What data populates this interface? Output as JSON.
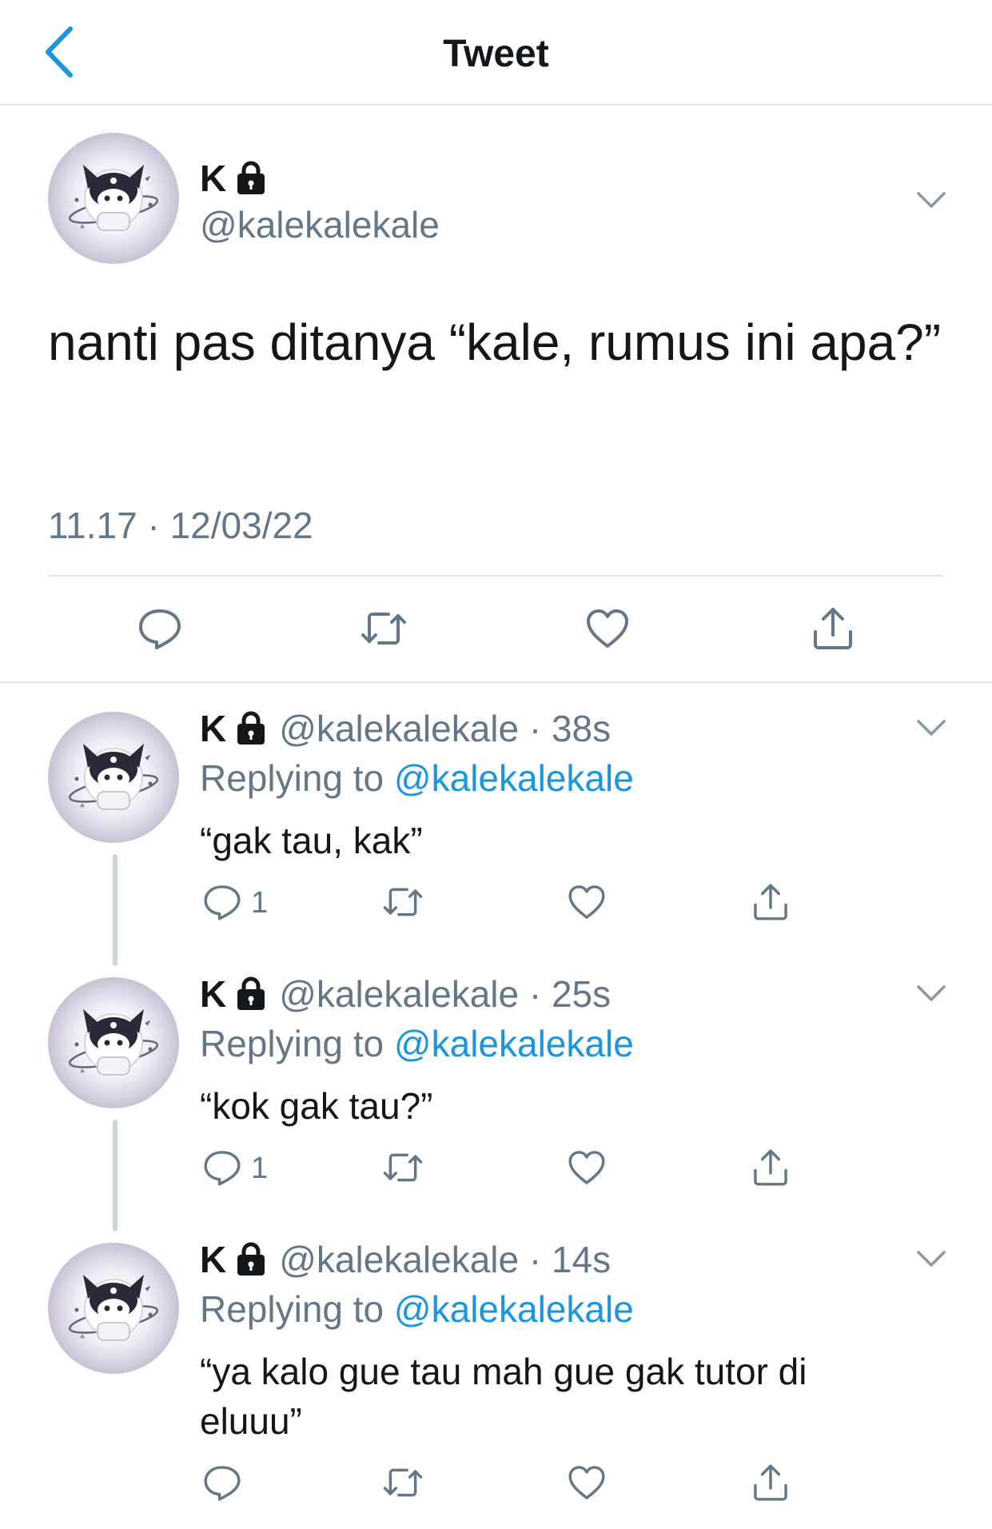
{
  "nav": {
    "title": "Tweet",
    "back_icon": "chevron-left-icon"
  },
  "colors": {
    "accent": "#1b95e0",
    "secondary_text": "#657786",
    "divider": "#e1e8ed"
  },
  "main_tweet": {
    "name": "K",
    "handle": "@kalekalekale",
    "text": "nanti pas ditanya “kale, rumus ini apa?”",
    "timestamp": "11.17 · 12/03/22"
  },
  "replies": [
    {
      "name": "K",
      "handle_time": "@kalekalekale · 38s",
      "replying_label": "Replying to",
      "replying_to": "@kalekalekale",
      "text": "“gak tau, kak”",
      "reply_count": "1"
    },
    {
      "name": "K",
      "handle_time": "@kalekalekale · 25s",
      "replying_label": "Replying to",
      "replying_to": "@kalekalekale",
      "text": "“kok gak tau?”",
      "reply_count": "1"
    },
    {
      "name": "K",
      "handle_time": "@kalekalekale · 14s",
      "replying_label": "Replying to",
      "replying_to": "@kalekalekale",
      "text": "“ya kalo gue tau mah gue gak tutor di eluuu”",
      "reply_count": ""
    }
  ]
}
